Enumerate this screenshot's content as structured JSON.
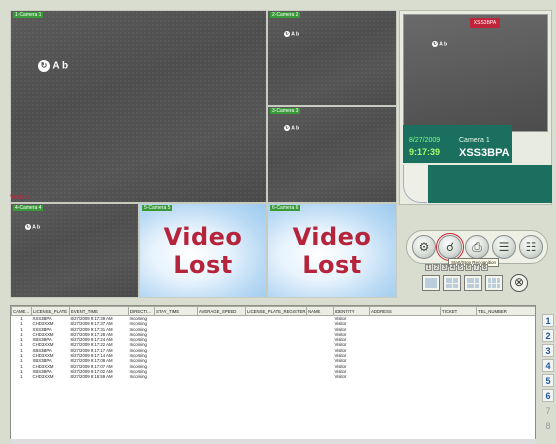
{
  "cameras": [
    {
      "label": "1-Camera 1",
      "watermark": "A b",
      "kind": "live"
    },
    {
      "label": "2-Camera 2",
      "watermark": "A b",
      "kind": "live"
    },
    {
      "label": "3-Camera 3",
      "watermark": "A b",
      "kind": "live"
    },
    {
      "label": "4-Camera 4",
      "watermark": "A b",
      "kind": "live"
    },
    {
      "label": "5-Camera 5",
      "watermark": "Video Lost",
      "kind": "lost"
    },
    {
      "label": "6-Camera 6",
      "watermark": "Video Lost",
      "kind": "lost"
    }
  ],
  "visitor_tag": "Visitors",
  "recognition": {
    "plate_tag": "XSS3BPA",
    "date": "8/27/2009",
    "time": "9:17:39",
    "camera": "Camera 1",
    "plate": "XSS3BPA"
  },
  "controls": {
    "tooltip": "Start/Stop Recognition",
    "pages": [
      "1",
      "2",
      "3",
      "4",
      "5",
      "6",
      "7",
      "8"
    ],
    "close_glyph": "⊗"
  },
  "table": {
    "columns": [
      "CAME...",
      "LICENSE_PLATE",
      "EVENT_TIME",
      "DIRECTI...",
      "STAY_TIME",
      "AVERAGE_SPEED",
      "LICENSE_PLATE_REGISTER...",
      "NAME",
      "IDENTITY",
      "ADDRESS",
      "TICKET",
      "TEL_NUMBER"
    ],
    "rows": [
      [
        "1",
        "XSS3BPA",
        "8/27/2009 9:17:39 AM",
        "Incoming",
        "",
        "",
        "",
        "",
        "Visitor",
        "",
        "",
        ""
      ],
      [
        "1",
        "CHD3XXM",
        "8/27/2009 9:17:37 AM",
        "Incoming",
        "",
        "",
        "",
        "",
        "Visitor",
        "",
        "",
        ""
      ],
      [
        "1",
        "XSS3BPA",
        "8/27/2009 9:17:31 AM",
        "Incoming",
        "",
        "",
        "",
        "",
        "Visitor",
        "",
        "",
        ""
      ],
      [
        "1",
        "CHD3XXM",
        "8/27/2009 9:17:28 AM",
        "Incoming",
        "",
        "",
        "",
        "",
        "Visitor",
        "",
        "",
        ""
      ],
      [
        "1",
        "XBS3BPA",
        "8/27/2009 9:17:24 AM",
        "Incoming",
        "",
        "",
        "",
        "",
        "Visitor",
        "",
        "",
        ""
      ],
      [
        "1",
        "CHD3XXM",
        "8/27/2009 9:17:22 AM",
        "Incoming",
        "",
        "",
        "",
        "",
        "Visitor",
        "",
        "",
        ""
      ],
      [
        "1",
        "XBS3BPA",
        "8/27/2009 9:17:17 AM",
        "Incoming",
        "",
        "",
        "",
        "",
        "Visitor",
        "",
        "",
        ""
      ],
      [
        "1",
        "CHD3XXM",
        "8/27/2009 9:17:14 AM",
        "Incoming",
        "",
        "",
        "",
        "",
        "Visitor",
        "",
        "",
        ""
      ],
      [
        "1",
        "XBS3BPA",
        "8/27/2009 9:17:08 AM",
        "Incoming",
        "",
        "",
        "",
        "",
        "Visitor",
        "",
        "",
        ""
      ],
      [
        "1",
        "CHD3XXM",
        "8/27/2009 9:17:07 AM",
        "Incoming",
        "",
        "",
        "",
        "",
        "Visitor",
        "",
        "",
        ""
      ],
      [
        "1",
        "XBS3BPA",
        "8/27/2009 9:17:02 AM",
        "Incoming",
        "",
        "",
        "",
        "",
        "Visitor",
        "",
        "",
        ""
      ],
      [
        "1",
        "CHD3XXM",
        "8/27/2009 9:16:59 AM",
        "Incoming",
        "",
        "",
        "",
        "",
        "Visitor",
        "",
        "",
        ""
      ]
    ]
  },
  "colors": {
    "lost_text": "#b5243a",
    "label_bg": "#3a9a3a",
    "info_bg": "#1a6f5e",
    "tab_text": "#1e5a9a"
  }
}
